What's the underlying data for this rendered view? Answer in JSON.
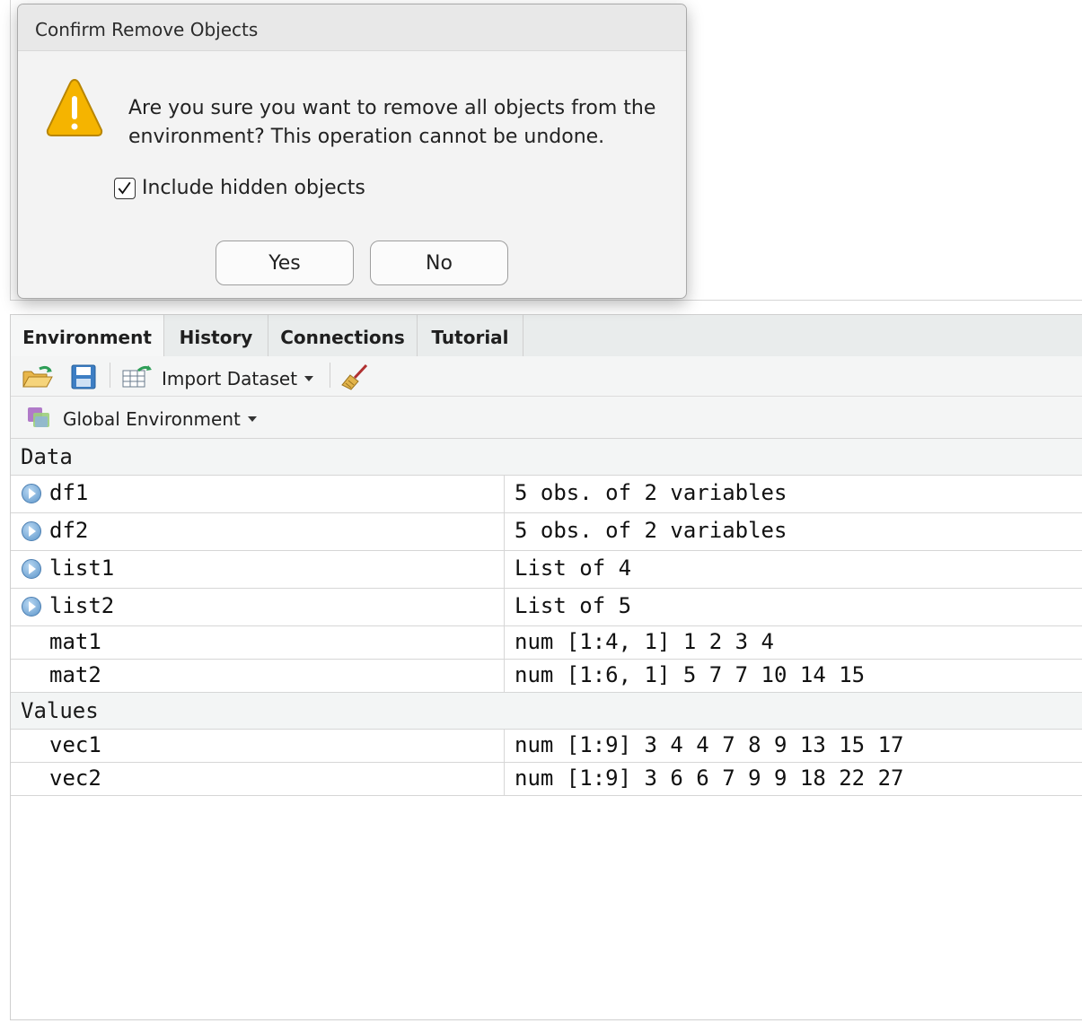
{
  "dialog": {
    "title": "Confirm Remove Objects",
    "message": "Are you sure you want to remove all objects from the environment? This operation cannot be undone.",
    "checkbox_label": "Include hidden objects",
    "checkbox_checked": true,
    "yes_label": "Yes",
    "no_label": "No"
  },
  "tabs": [
    {
      "label": "Environment",
      "active": true
    },
    {
      "label": "History",
      "active": false
    },
    {
      "label": "Connections",
      "active": false
    },
    {
      "label": "Tutorial",
      "active": false
    }
  ],
  "toolbar": {
    "import_dataset_label": "Import Dataset",
    "icons": [
      "open-folder-icon",
      "save-icon",
      "import-dataset-icon",
      "broom-icon"
    ]
  },
  "env_selector": {
    "label": "Global Environment"
  },
  "sections": {
    "data_label": "Data",
    "values_label": "Values"
  },
  "data_rows": [
    {
      "name": "df1",
      "value": "5 obs. of 2 variables",
      "expandable": true
    },
    {
      "name": "df2",
      "value": "5 obs. of 2 variables",
      "expandable": true
    },
    {
      "name": "list1",
      "value": "List of 4",
      "expandable": true
    },
    {
      "name": "list2",
      "value": "List of 5",
      "expandable": true
    },
    {
      "name": "mat1",
      "value": "num [1:4, 1] 1 2 3 4",
      "expandable": false
    },
    {
      "name": "mat2",
      "value": "num [1:6, 1] 5 7 7 10 14 15",
      "expandable": false
    }
  ],
  "value_rows": [
    {
      "name": "vec1",
      "value": "num [1:9] 3 4 4 7 8 9 13 15 17"
    },
    {
      "name": "vec2",
      "value": "num [1:9] 3 6 6 7 9 9 18 22 27"
    }
  ],
  "colors": {
    "warning": "#f5b400",
    "expander": "#5c95c9",
    "tabbar": "#e9ecec"
  }
}
